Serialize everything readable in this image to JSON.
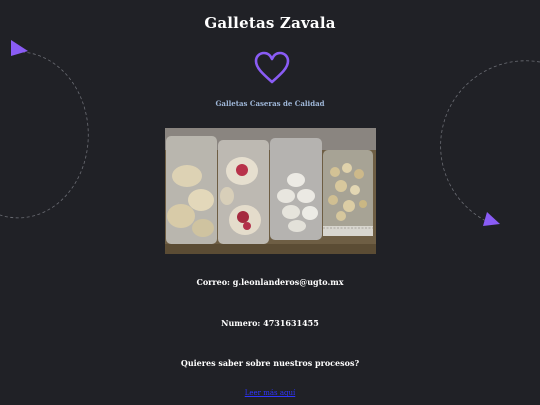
{
  "site": {
    "title": "Galletas Zavala",
    "tagline": "Galletas Caseras de Calidad"
  },
  "icons": {
    "heart": "heart-icon",
    "arrow": "triangle-arrow-icon"
  },
  "contact": {
    "email": "Correo: g.leonlanderos@ugto.mx",
    "phone": "Numero: 4731631455"
  },
  "process": {
    "question": "Quieres saber sobre nuestros procesos?",
    "link_label": "Leer más aquí"
  },
  "colors": {
    "background": "#202126",
    "accent": "#8a5cf5",
    "text": "#ffffff",
    "tagline": "#9fb7d8",
    "link": "#2f35ff"
  }
}
